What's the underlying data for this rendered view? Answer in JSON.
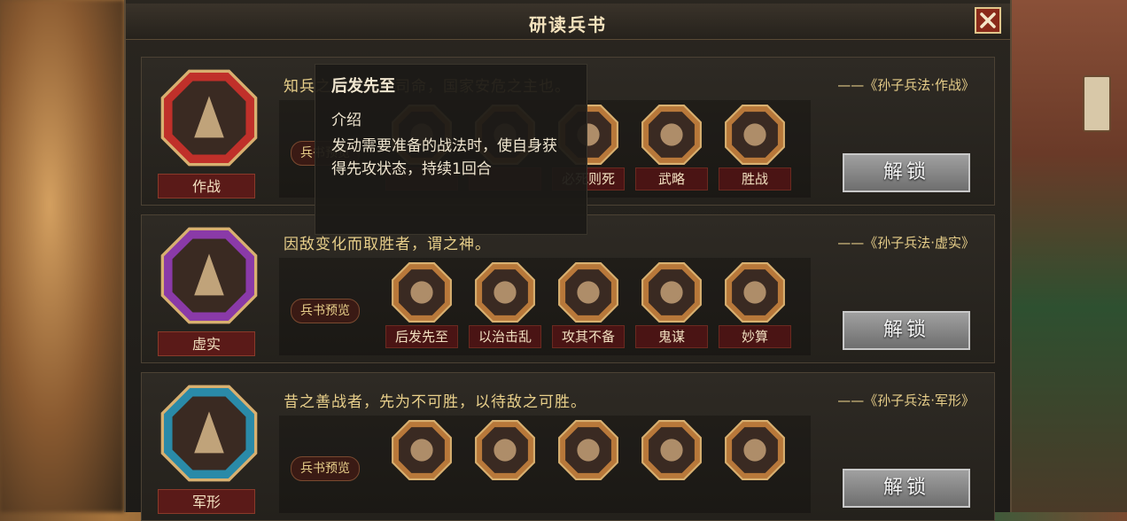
{
  "window": {
    "title": "研读兵书"
  },
  "cards": [
    {
      "emblem_name": "作战",
      "quote": "知兵之将，民之司命，国家安危之主也。",
      "source": "——《孙子兵法·作战》",
      "preview_label": "兵书预览",
      "skills": [
        "",
        "",
        "必死则死",
        "武略",
        "胜战"
      ],
      "unlock_label": "解锁",
      "color": "#c0302a"
    },
    {
      "emblem_name": "虚实",
      "quote": "因敌变化而取胜者，谓之神。",
      "source": "——《孙子兵法·虚实》",
      "preview_label": "兵书预览",
      "skills": [
        "后发先至",
        "以治击乱",
        "攻其不备",
        "鬼谋",
        "妙算"
      ],
      "unlock_label": "解锁",
      "color": "#8a3aa8"
    },
    {
      "emblem_name": "军形",
      "quote": "昔之善战者，先为不可胜，以待敌之可胜。",
      "source": "——《孙子兵法·军形》",
      "preview_label": "兵书预览",
      "skills": [
        "",
        "",
        "",
        "",
        ""
      ],
      "unlock_label": "解锁",
      "color": "#2a8aa8"
    }
  ],
  "tooltip": {
    "title": "后发先至",
    "heading": "介绍",
    "text": "发动需要准备的战法时，使自身获得先攻状态，持续1回合"
  },
  "icons": {
    "close": "close-icon",
    "emblem": "emblem-icon",
    "skill": "skill-icon"
  }
}
